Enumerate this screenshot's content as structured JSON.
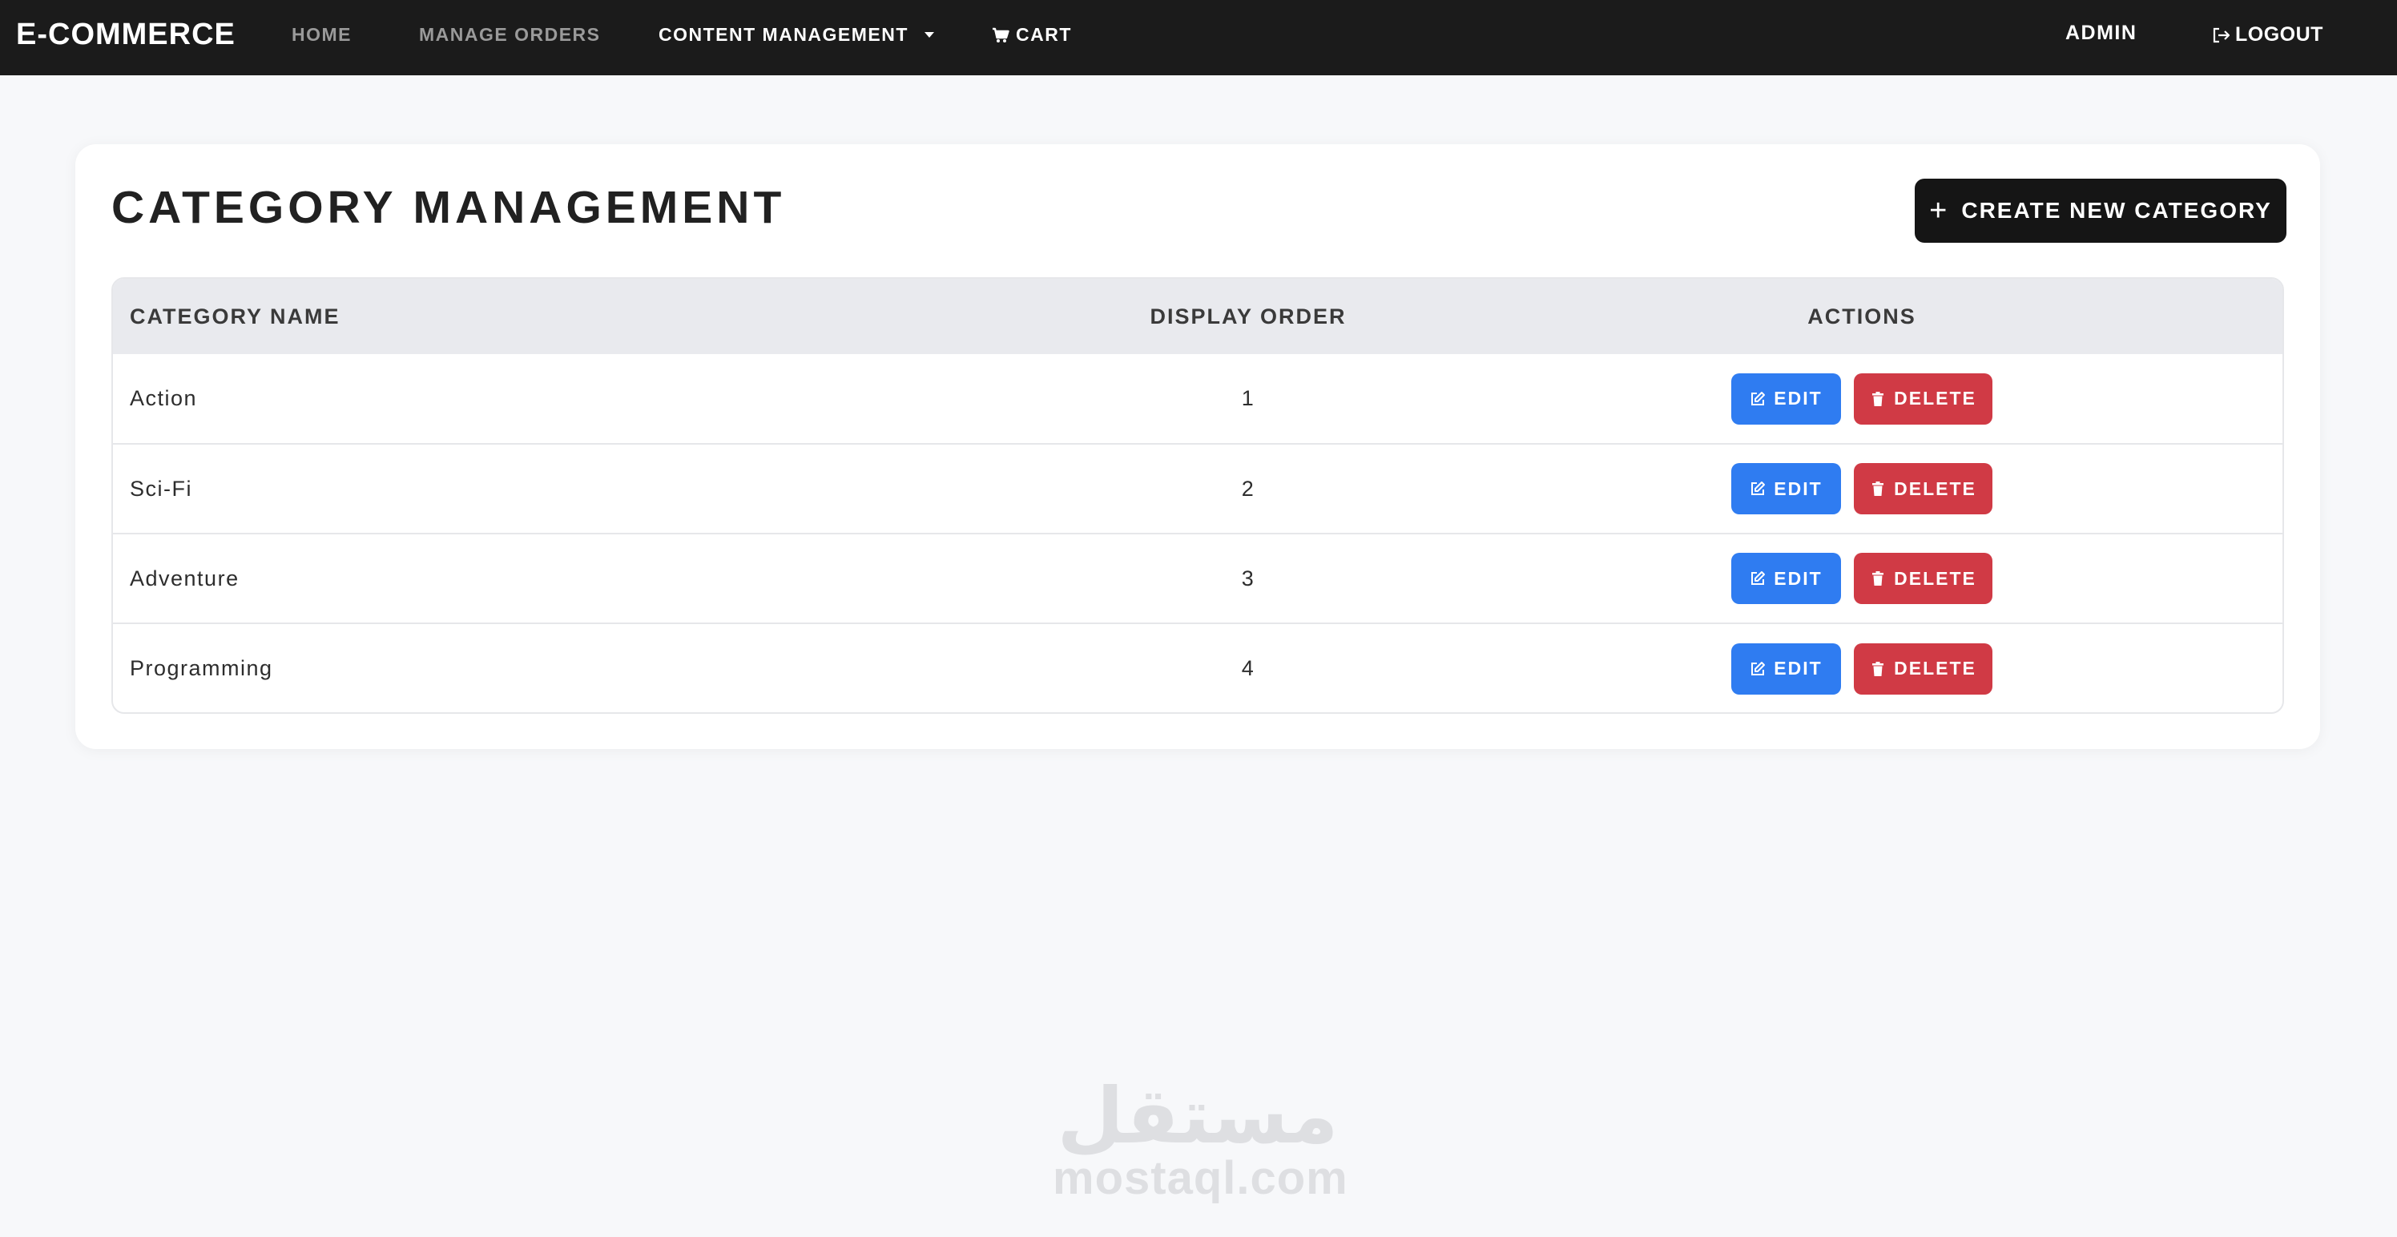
{
  "nav": {
    "brand": "E-COMMERCE",
    "links": [
      {
        "label": "HOME"
      },
      {
        "label": "MANAGE ORDERS"
      },
      {
        "label": "CONTENT MANAGEMENT"
      },
      {
        "label": "CART"
      }
    ],
    "user": "ADMIN",
    "logout": "LOGOUT"
  },
  "page": {
    "title": "CATEGORY MANAGEMENT",
    "create_button": "CREATE NEW CATEGORY"
  },
  "table": {
    "headers": [
      "CATEGORY NAME",
      "DISPLAY ORDER",
      "ACTIONS"
    ],
    "rows": [
      {
        "name": "Action",
        "order": "1"
      },
      {
        "name": "Sci-Fi",
        "order": "2"
      },
      {
        "name": "Adventure",
        "order": "3"
      },
      {
        "name": "Programming",
        "order": "4"
      }
    ],
    "edit_label": "EDIT",
    "delete_label": "DELETE"
  },
  "watermark": {
    "arabic": "مستقل",
    "latin": "mostaql.com"
  },
  "colors": {
    "navbar": "#1b1b1b",
    "edit": "#2f7cf1",
    "delete": "#d03a45",
    "create": "#151515"
  }
}
